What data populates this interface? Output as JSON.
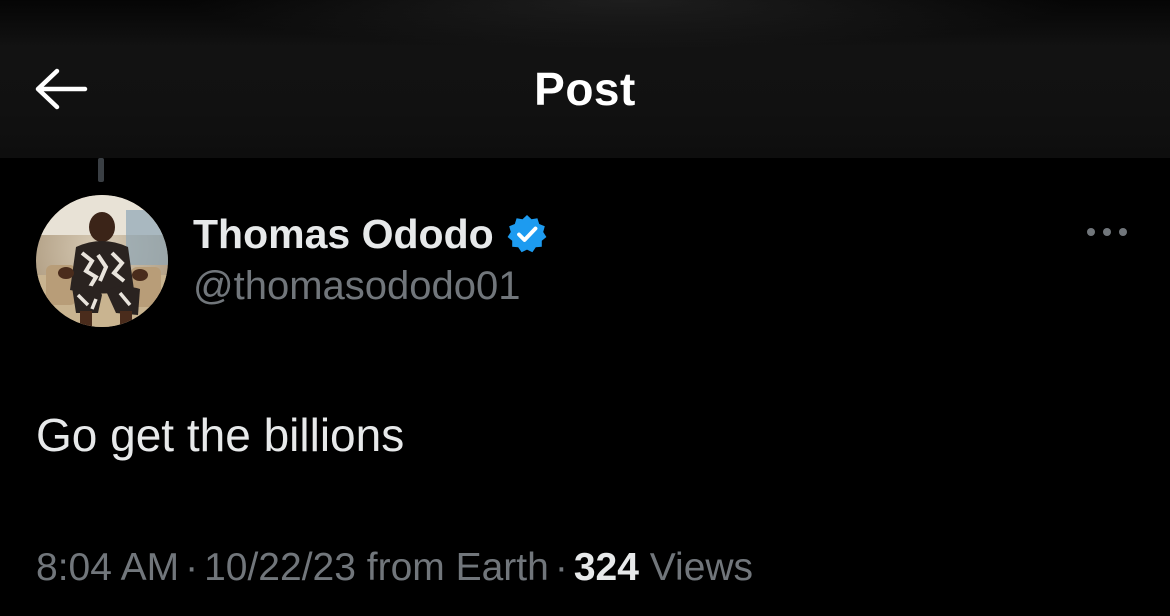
{
  "header": {
    "title": "Post",
    "back_icon": "arrow-left-icon"
  },
  "post": {
    "author": {
      "name": "Thomas Ododo",
      "handle": "@thomasododo01",
      "verified": true,
      "verified_icon": "verified-badge-icon",
      "verified_color": "#1d9bf0"
    },
    "more_icon": "more-horizontal-icon",
    "text": "Go get the billions",
    "meta": {
      "time": "8:04 AM",
      "separator": "·",
      "date": "10/22/23",
      "source": "from Earth",
      "views_count": "324",
      "views_label": "Views"
    }
  },
  "colors": {
    "background": "#000000",
    "header_background": "#111111",
    "primary_text": "#e7e9ea",
    "secondary_text": "#71767b",
    "accent": "#1d9bf0"
  }
}
